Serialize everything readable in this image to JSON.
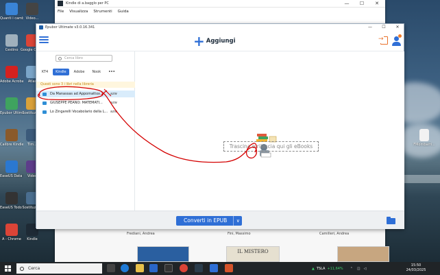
{
  "desktop": {
    "icons_left": [
      {
        "label": "Quanti i cambiamenti",
        "color": "#3a84d6"
      },
      {
        "label": "Cestino",
        "color": "#9fb0bd"
      },
      {
        "label": "Adobe Acrobat",
        "color": "#d4211f"
      },
      {
        "label": "Epubor Ultimate",
        "color": "#3fa35f"
      },
      {
        "label": "Calibre Kindle eBook",
        "color": "#8a5a2b"
      },
      {
        "label": "EaseUS Data Recovery",
        "color": "#2b78d0"
      },
      {
        "label": "EaseUS Todo Backup",
        "color": "#333333"
      },
      {
        "label": "A - Chrome",
        "color": "#db4437"
      }
    ],
    "icons_col2": [
      {
        "label": "Video...",
        "color": "#444444"
      },
      {
        "label": "Google Chrome",
        "color": "#db4437"
      },
      {
        "label": "Atlas",
        "color": "#7aa5c8"
      },
      {
        "label": "Sostituzioni",
        "color": "#d9a13a"
      },
      {
        "label": "Tim...",
        "color": "#3b5a7a"
      },
      {
        "label": "Video",
        "color": "#5d3d8a"
      },
      {
        "label": "Sostituzioni",
        "color": "#4a6e8f"
      },
      {
        "label": "Kindle",
        "color": "#1e2a35"
      }
    ],
    "right_icon": {
      "label": "FMombarri..."
    }
  },
  "kindle_window": {
    "title": "Kindle di a.bagglo per PC",
    "menu": [
      "File",
      "Visualizza",
      "Strumenti",
      "Guida"
    ],
    "authors": [
      "Frediani, Andrea",
      "Fini, Massimo",
      "Camilleri, Andrea"
    ],
    "book_banner": "IL MISTERO"
  },
  "epubor": {
    "title": "Epubor Ultimate v3.0.16.341",
    "add_label": "Aggiungi",
    "search_placeholder": "Cerca libro",
    "tabs": [
      "KT4",
      "Kindle",
      "Adobe",
      "Nook",
      "•••"
    ],
    "active_tab": "Kindle",
    "hint": "Questi sono 3 i libri nella libreria",
    "books": [
      {
        "title": "Da Manassas ad Appomattox...",
        "format": "azw",
        "selected": true
      },
      {
        "title": "GIUSEPPE PEANO: MATEMATI...",
        "format": "azw",
        "selected": false
      },
      {
        "title": "Lo Zingarelli Vocabolario della L...",
        "format": "azw",
        "selected": false
      }
    ],
    "drop_text": "Trascina e rilascia qui gli eBooks",
    "convert_label": "Converti in EPUB",
    "convert_arrow": "∨"
  },
  "taskbar": {
    "search_placeholder": "Cerca",
    "stock_ticker": "TSLA",
    "stock_change": "+11,64%",
    "time": "15:50",
    "date": "24/03/2025"
  },
  "colors": {
    "accent": "#2f6fd6",
    "annotation": "#d40000",
    "stock_green": "#3fd06b"
  }
}
